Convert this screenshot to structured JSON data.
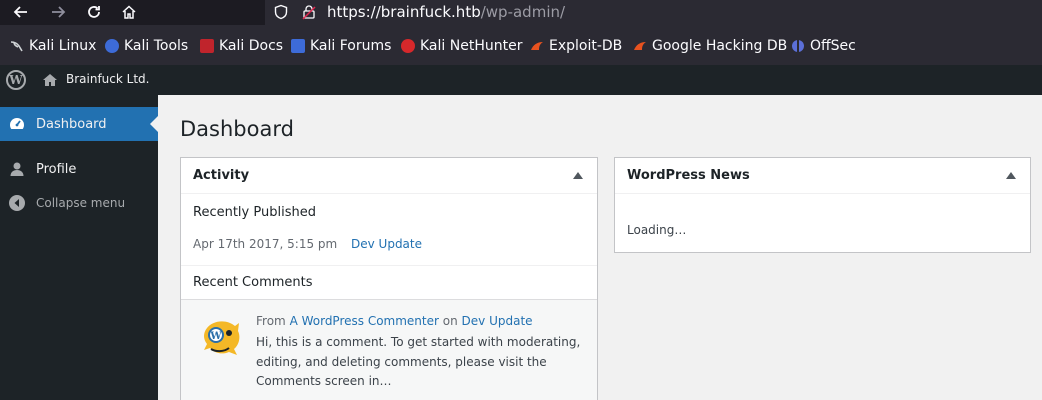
{
  "browser": {
    "url_host": "https://brainfuck.htb",
    "url_path": "/wp-admin/",
    "bookmarks": [
      {
        "label": "Kali Linux",
        "icon": "kali-dragon-icon",
        "color": "#cfd3d6"
      },
      {
        "label": "Kali Tools",
        "icon": "kali-tools-icon",
        "color": "#3d6bd8"
      },
      {
        "label": "Kali Docs",
        "icon": "kali-docs-icon",
        "color": "#c0242c"
      },
      {
        "label": "Kali Forums",
        "icon": "kali-forums-icon",
        "color": "#3d6bd8"
      },
      {
        "label": "Kali NetHunter",
        "icon": "nethunter-icon",
        "color": "#d6282b"
      },
      {
        "label": "Exploit-DB",
        "icon": "exploitdb-icon",
        "color": "#e8521f"
      },
      {
        "label": "Google Hacking DB",
        "icon": "ghdb-icon",
        "color": "#e8521f"
      },
      {
        "label": "OffSec",
        "icon": "offsec-icon",
        "color": "#5b6fd8"
      }
    ]
  },
  "adminbar": {
    "site_name": "Brainfuck Ltd."
  },
  "sidebar": {
    "items": [
      {
        "label": "Dashboard",
        "icon": "dashboard-icon"
      },
      {
        "label": "Profile",
        "icon": "user-icon"
      },
      {
        "label": "Collapse menu",
        "icon": "collapse-icon"
      }
    ]
  },
  "main": {
    "title": "Dashboard",
    "activity": {
      "heading": "Activity",
      "recently_published": "Recently Published",
      "post_date": "Apr 17th 2017, 5:15 pm",
      "post_title": "Dev Update",
      "recent_comments": "Recent Comments",
      "comment_from": "From",
      "comment_author": "A WordPress Commenter",
      "comment_on": "on",
      "comment_post": "Dev Update",
      "comment_text": "Hi, this is a comment. To get started with moderating, editing, and deleting comments, please visit the Comments screen in…"
    },
    "news": {
      "heading": "WordPress News",
      "loading": "Loading…"
    }
  },
  "colors": {
    "accent": "#2271b1",
    "admin_dark": "#1d2327"
  }
}
